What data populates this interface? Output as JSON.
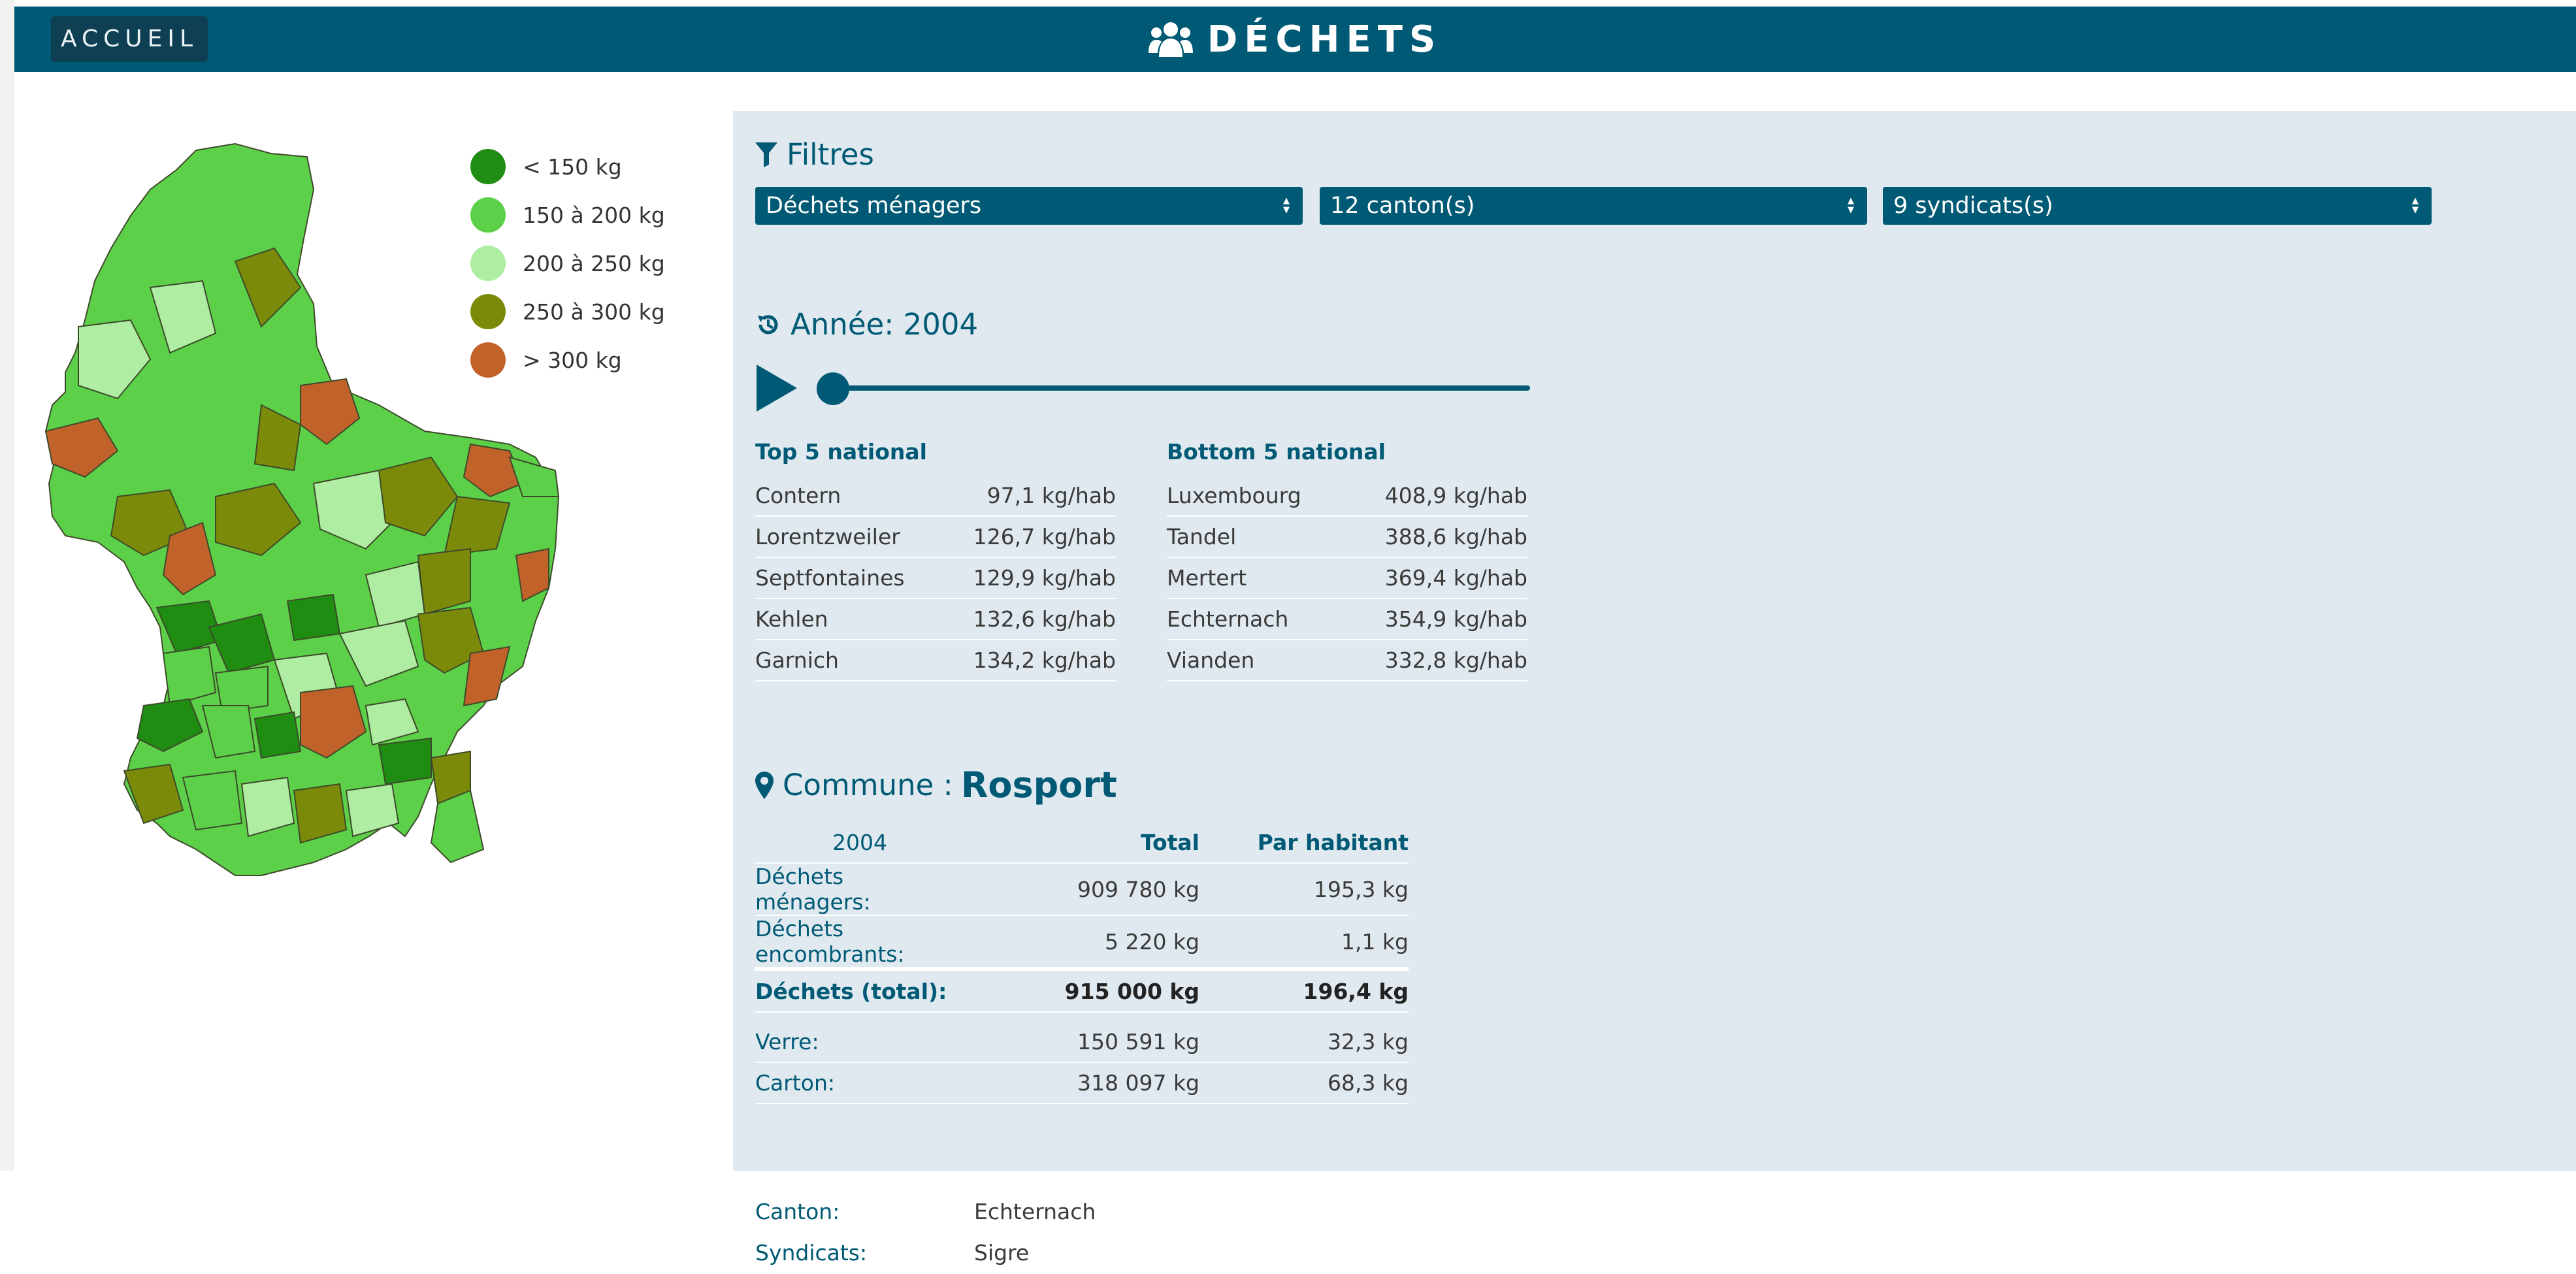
{
  "header": {
    "home_label": "ACCUEIL",
    "title": "DÉCHETS",
    "title_icon": "users-icon"
  },
  "legend": [
    {
      "label": "< 150 kg",
      "color": "#1f8c12"
    },
    {
      "label": "150 à 200 kg",
      "color": "#5cd048"
    },
    {
      "label": "200 à 250 kg",
      "color": "#aeeda2"
    },
    {
      "label": "250 à 300 kg",
      "color": "#7c8a0a"
    },
    {
      "label": "> 300 kg",
      "color": "#c0622a"
    }
  ],
  "filters": {
    "title": "Filtres",
    "selects": [
      {
        "value": "Déchets ménagers"
      },
      {
        "value": "12 canton(s)"
      },
      {
        "value": "9 syndicats(s)"
      }
    ]
  },
  "year": {
    "label": "Année: 2004",
    "slider_fraction": 0.0
  },
  "top5": {
    "title": "Top 5 national",
    "rows": [
      {
        "name": "Contern",
        "value": "97,1 kg/hab"
      },
      {
        "name": "Lorentzweiler",
        "value": "126,7 kg/hab"
      },
      {
        "name": "Septfontaines",
        "value": "129,9 kg/hab"
      },
      {
        "name": "Kehlen",
        "value": "132,6 kg/hab"
      },
      {
        "name": "Garnich",
        "value": "134,2 kg/hab"
      }
    ]
  },
  "bottom5": {
    "title": "Bottom 5 national",
    "rows": [
      {
        "name": "Luxembourg",
        "value": "408,9 kg/hab"
      },
      {
        "name": "Tandel",
        "value": "388,6 kg/hab"
      },
      {
        "name": "Mertert",
        "value": "369,4 kg/hab"
      },
      {
        "name": "Echternach",
        "value": "354,9 kg/hab"
      },
      {
        "name": "Vianden",
        "value": "332,8 kg/hab"
      }
    ]
  },
  "commune": {
    "label": "Commune :",
    "name": "Rosport",
    "head": {
      "year": "2004",
      "total": "Total",
      "per": "Par habitant"
    },
    "rows": [
      {
        "k": "Déchets ménagers:",
        "total": "909 780 kg",
        "per": "195,3 kg"
      },
      {
        "k": "Déchets encombrants:",
        "total": "5 220 kg",
        "per": "1,1 kg"
      }
    ],
    "total_row": {
      "k": "Déchets (total):",
      "total": "915 000 kg",
      "per": "196,4 kg"
    },
    "rows2": [
      {
        "k": "Verre:",
        "total": "150 591 kg",
        "per": "32,3 kg"
      },
      {
        "k": "Carton:",
        "total": "318 097 kg",
        "per": "68,3 kg"
      }
    ],
    "info": [
      {
        "k": "Canton:",
        "v": "Echternach"
      },
      {
        "k": "Syndicats:",
        "v": "Sigre"
      }
    ]
  }
}
